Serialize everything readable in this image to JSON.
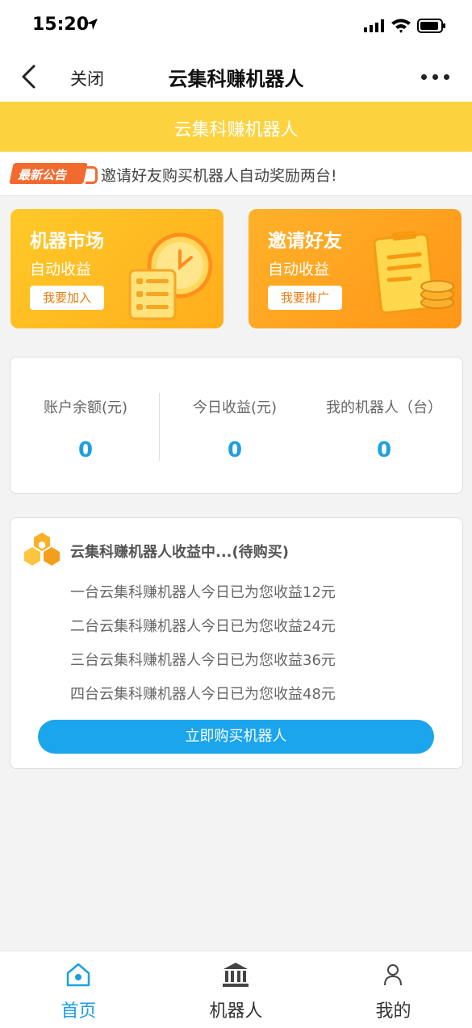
{
  "status": {
    "time": "15:20"
  },
  "nav": {
    "close_label": "关闭",
    "title": "云集科赚机器人"
  },
  "banner": {
    "title": "云集科赚机器人"
  },
  "notice": {
    "badge": "最新公告",
    "text": "邀请好友购买机器人自动奖励两台!"
  },
  "cards": [
    {
      "title": "机器市场",
      "subtitle": "自动收益",
      "button": "我要加入"
    },
    {
      "title": "邀请好友",
      "subtitle": "自动收益",
      "button": "我要推广"
    }
  ],
  "stats": [
    {
      "label": "账户余额(元)",
      "value": "0"
    },
    {
      "label": "今日收益(元)",
      "value": "0"
    },
    {
      "label": "我的机器人（台）",
      "value": "0"
    }
  ],
  "earnings": {
    "title": "云集科赚机器人收益中...(待购买)",
    "lines": [
      "一台云集科赚机器人今日已为您收益12元",
      "二台云集科赚机器人今日已为您收益24元",
      "三台云集科赚机器人今日已为您收益36元",
      "四台云集科赚机器人今日已为您收益48元"
    ],
    "button": "立即购买机器人"
  },
  "tabs": [
    {
      "label": "首页",
      "icon": "home-icon",
      "active": true
    },
    {
      "label": "机器人",
      "icon": "bank-icon",
      "active": false
    },
    {
      "label": "我的",
      "icon": "user-icon",
      "active": false
    }
  ],
  "colors": {
    "accent": "#1e9fe0",
    "banner": "#fcd33f",
    "orange": "#ffa51f",
    "badge": "#f26a2e"
  }
}
